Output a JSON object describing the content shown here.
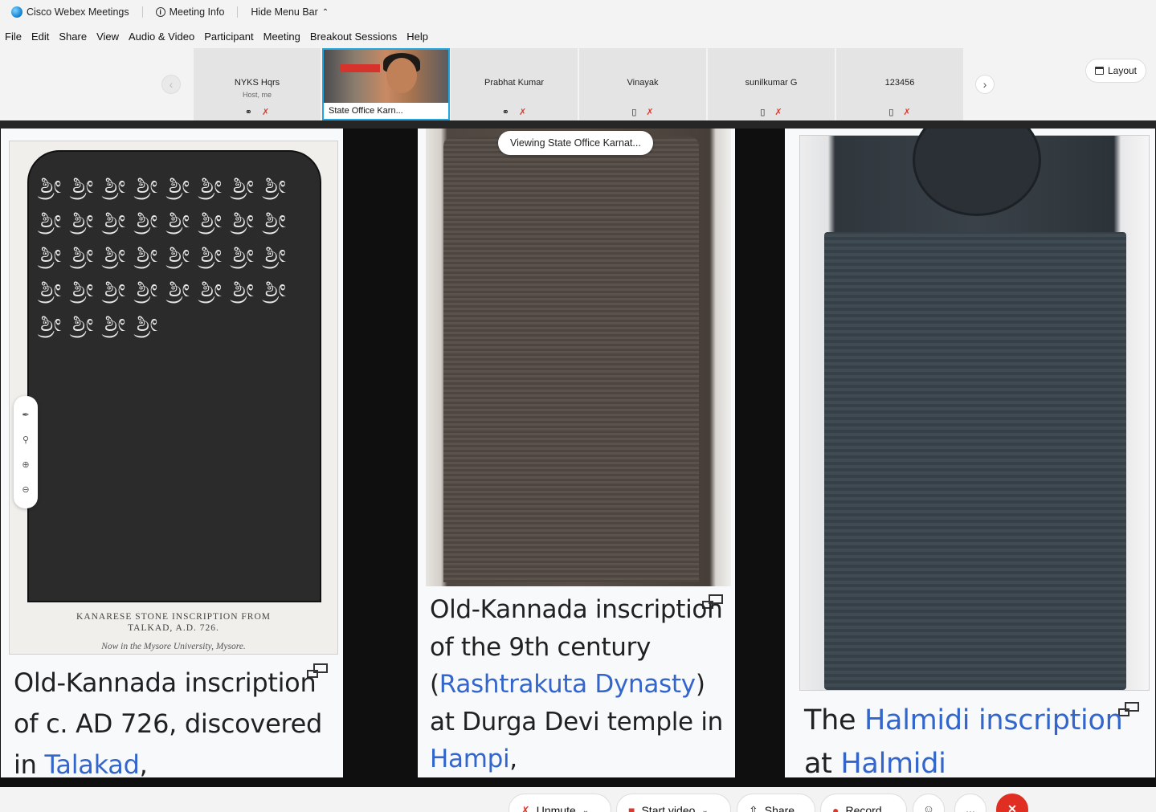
{
  "titlebar": {
    "app_name": "Cisco Webex Meetings",
    "meeting_info": "Meeting Info",
    "hide_menu": "Hide Menu Bar"
  },
  "menubar": {
    "items": [
      "File",
      "Edit",
      "Share",
      "View",
      "Audio & Video",
      "Participant",
      "Meeting",
      "Breakout Sessions",
      "Help"
    ]
  },
  "participants": [
    {
      "name": "NYKS Hqrs",
      "sub": "Host, me"
    },
    {
      "name": "State Office Karn..."
    },
    {
      "name": "Prabhat Kumar"
    },
    {
      "name": "Vinayak"
    },
    {
      "name": "sunilkumar G"
    },
    {
      "name": "123456"
    }
  ],
  "layout_label": "Layout",
  "viewing_label": "Viewing State Office Karnat...",
  "slides": {
    "s1": {
      "caption_line1": "KANARESE STONE INSCRIPTION FROM",
      "caption_line2": "TALKAD, A.D. 726.",
      "caption_line3": "Now in the Mysore University, Mysore.",
      "text_a": "Old-Kannada inscription of c. AD 726, discovered in ",
      "link_a": "Talakad",
      "text_b": ","
    },
    "s2": {
      "text_a": "Old-Kannada inscription of the 9th century (",
      "link_a": "Rashtrakuta Dynasty",
      "text_b": ") at Durga Devi temple in ",
      "link_b": "Hampi",
      "text_c": ","
    },
    "s3": {
      "text_a": "The ",
      "link_a": "Halmidi inscription",
      "text_b": " at ",
      "link_b": "Halmidi"
    }
  },
  "controls": {
    "unmute": "Unmute",
    "start_video": "Start video",
    "share": "Share",
    "record": "Record",
    "more": "..."
  },
  "colors": {
    "accent": "#23a6e0",
    "link": "#3366cc",
    "danger": "#e02f22"
  }
}
